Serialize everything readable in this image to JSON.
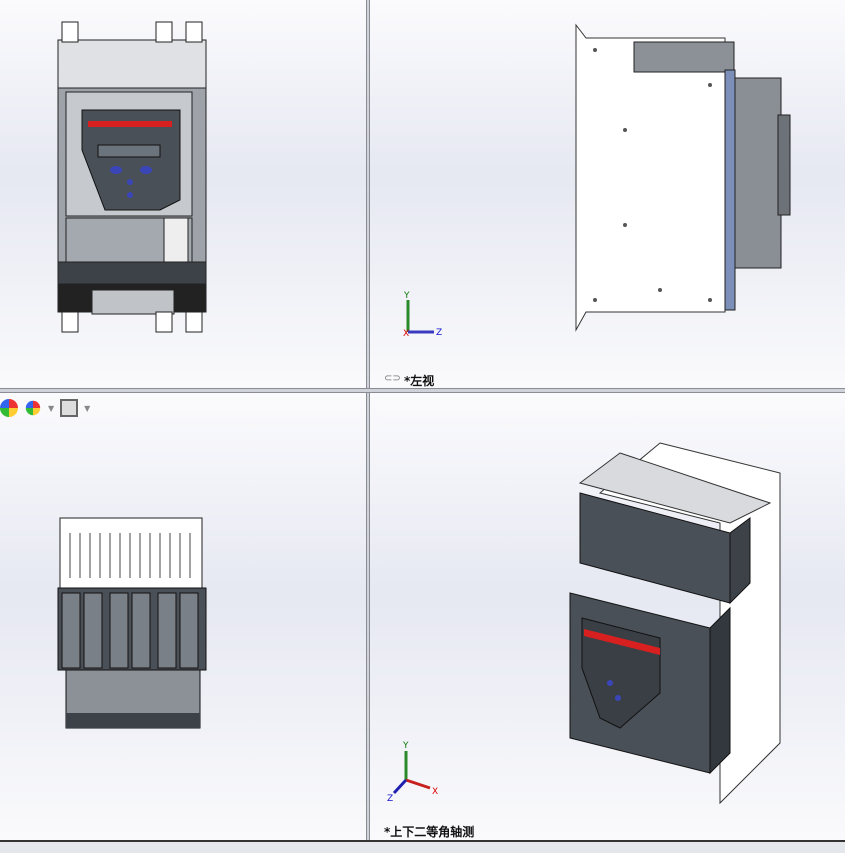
{
  "viewports": {
    "top_right": {
      "label": "*左视",
      "icon": "link-icon"
    },
    "bottom_right": {
      "label": "*上下二等角轴测"
    },
    "bottom_left": {
      "toolbar": [
        "appearance-icon",
        "scene-icon",
        "display-settings-icon"
      ]
    }
  },
  "triad": {
    "x": "X",
    "y": "Y",
    "z": "Z"
  },
  "colors": {
    "accent_red": "#d82020",
    "body": "#4a5058",
    "panel": "#a7acb3",
    "sheet": "#ffffff"
  }
}
